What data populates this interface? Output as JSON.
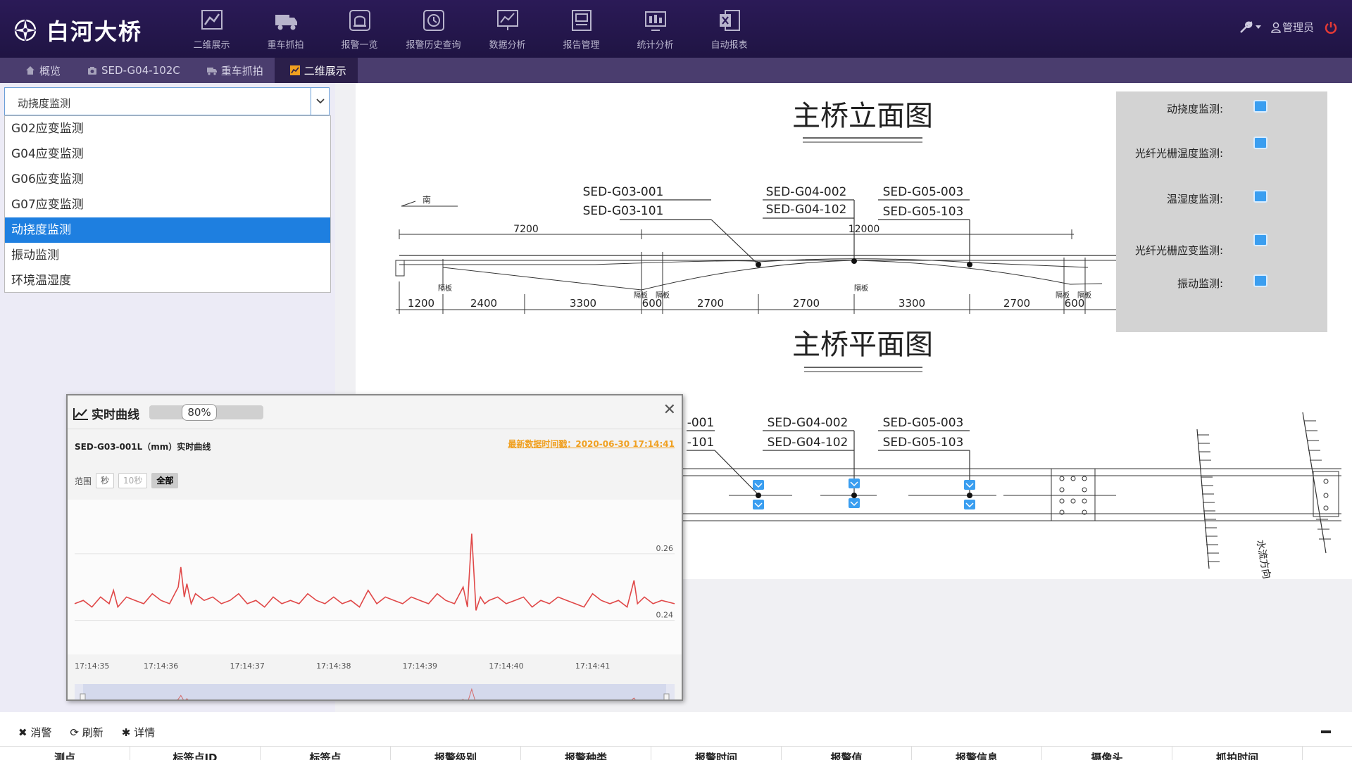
{
  "app": {
    "title": "白河大桥"
  },
  "nav": [
    {
      "label": "二维展示",
      "icon": "line-chart-icon"
    },
    {
      "label": "重车抓拍",
      "icon": "truck-icon"
    },
    {
      "label": "报警一览",
      "icon": "alarm-bell-icon"
    },
    {
      "label": "报警历史查询",
      "icon": "alarm-history-icon"
    },
    {
      "label": "数据分析",
      "icon": "data-analysis-icon"
    },
    {
      "label": "报告管理",
      "icon": "report-icon"
    },
    {
      "label": "统计分析",
      "icon": "statistics-icon"
    },
    {
      "label": "自动报表",
      "icon": "excel-icon"
    }
  ],
  "header": {
    "user": "管理员"
  },
  "tabs": [
    {
      "label": "概览",
      "icon": "home-icon"
    },
    {
      "label": "SED-G04-102C",
      "icon": "camera-icon"
    },
    {
      "label": "重车抓拍",
      "icon": "truck-icon"
    },
    {
      "label": "二维展示",
      "icon": "chart-icon",
      "active": true
    }
  ],
  "select": {
    "value": "动挠度监测",
    "options": [
      "G02应变监测",
      "G04应变监测",
      "G06应变监测",
      "G07应变监测",
      "动挠度监测",
      "振动监测",
      "环境温湿度"
    ],
    "selected_index": 4
  },
  "drawing": {
    "elevation_title": "主桥立面图",
    "plan_title": "主桥平面图",
    "south_mark": "南",
    "sensors_top": [
      [
        "SED-G03-001",
        "SED-G03-101"
      ],
      [
        "SED-G04-002",
        "SED-G04-102"
      ],
      [
        "SED-G05-003",
        "SED-G05-103"
      ]
    ],
    "sensors_plan": [
      [
        "-001",
        "-101"
      ],
      [
        "SED-G04-002",
        "SED-G04-102"
      ],
      [
        "SED-G05-003",
        "SED-G05-103"
      ]
    ],
    "span_top": [
      "7200",
      "12000"
    ],
    "dims": [
      "1200",
      "2400",
      "3300",
      "600",
      "2700",
      "2700",
      "3300",
      "2700",
      "600"
    ],
    "diaphragm": "隔板",
    "flow_label": "水流方向"
  },
  "legend": [
    {
      "label": "动挠度监测:",
      "icon": "deflection-sensor-icon"
    },
    {
      "label": "光纤光栅温度监测:",
      "icon": "fbg-temperature-sensor-icon"
    },
    {
      "label": "温湿度监测:",
      "icon": "humidity-sensor-icon"
    },
    {
      "label": "光纤光栅应变监测:",
      "icon": "fbg-strain-sensor-icon"
    },
    {
      "label": "振动监测:",
      "icon": "vibration-sensor-icon"
    }
  ],
  "popup": {
    "title": "实时曲线",
    "progress_text": "80%",
    "progress": 0.8,
    "series_title": "SED-G03-001L（mm）实时曲线",
    "latest_time": "最新数据时间戳：2020-06-30 17:14:41",
    "range_label": "范围",
    "range_buttons": [
      "秒",
      "10秒",
      "全部"
    ]
  },
  "chart_data": {
    "type": "line",
    "title": "SED-G03-001L（mm）实时曲线",
    "xlabel": "",
    "ylabel": "",
    "x_ticks": [
      "17:14:35",
      "17:14:36",
      "17:14:37",
      "17:14:38",
      "17:14:39",
      "17:14:40",
      "17:14:41"
    ],
    "y_ticks": [
      "0.24",
      "0.26"
    ],
    "ylim": [
      0.234,
      0.272
    ],
    "series": [
      {
        "color": "#e04848",
        "x": [
          0,
          0.1,
          0.2,
          0.3,
          0.4,
          0.45,
          0.5,
          0.6,
          0.7,
          0.8,
          0.9,
          1.0,
          1.1,
          1.2,
          1.23,
          1.27,
          1.3,
          1.35,
          1.4,
          1.5,
          1.6,
          1.7,
          1.8,
          1.9,
          2.0,
          2.1,
          2.2,
          2.3,
          2.4,
          2.5,
          2.6,
          2.7,
          2.8,
          2.9,
          3.0,
          3.1,
          3.2,
          3.3,
          3.4,
          3.5,
          3.6,
          3.7,
          3.8,
          3.9,
          4.0,
          4.1,
          4.2,
          4.3,
          4.4,
          4.5,
          4.55,
          4.6,
          4.65,
          4.7,
          4.75,
          4.8,
          4.9,
          5.0,
          5.1,
          5.2,
          5.3,
          5.4,
          5.5,
          5.6,
          5.7,
          5.8,
          5.9,
          6.0,
          6.1,
          6.2,
          6.3,
          6.4,
          6.48,
          6.52,
          6.6,
          6.7,
          6.8,
          6.95
        ],
        "values": [
          0.245,
          0.246,
          0.244,
          0.247,
          0.245,
          0.249,
          0.244,
          0.247,
          0.246,
          0.245,
          0.248,
          0.246,
          0.245,
          0.25,
          0.256,
          0.247,
          0.251,
          0.245,
          0.248,
          0.246,
          0.247,
          0.245,
          0.246,
          0.248,
          0.245,
          0.246,
          0.244,
          0.247,
          0.245,
          0.246,
          0.245,
          0.248,
          0.246,
          0.245,
          0.247,
          0.245,
          0.246,
          0.244,
          0.249,
          0.245,
          0.247,
          0.246,
          0.245,
          0.247,
          0.246,
          0.245,
          0.248,
          0.246,
          0.245,
          0.25,
          0.244,
          0.266,
          0.243,
          0.247,
          0.245,
          0.246,
          0.247,
          0.245,
          0.246,
          0.247,
          0.244,
          0.246,
          0.245,
          0.247,
          0.246,
          0.245,
          0.244,
          0.248,
          0.246,
          0.245,
          0.246,
          0.244,
          0.252,
          0.245,
          0.247,
          0.245,
          0.246,
          0.245
        ]
      }
    ]
  },
  "toolbar": {
    "dismiss": "消警",
    "refresh": "刷新",
    "detail": "详情"
  },
  "table": {
    "headers": [
      "测点",
      "标签点ID",
      "标签点",
      "报警级别",
      "报警种类",
      "报警时间",
      "报警值",
      "报警信息",
      "摄像头",
      "抓拍时间"
    ]
  }
}
